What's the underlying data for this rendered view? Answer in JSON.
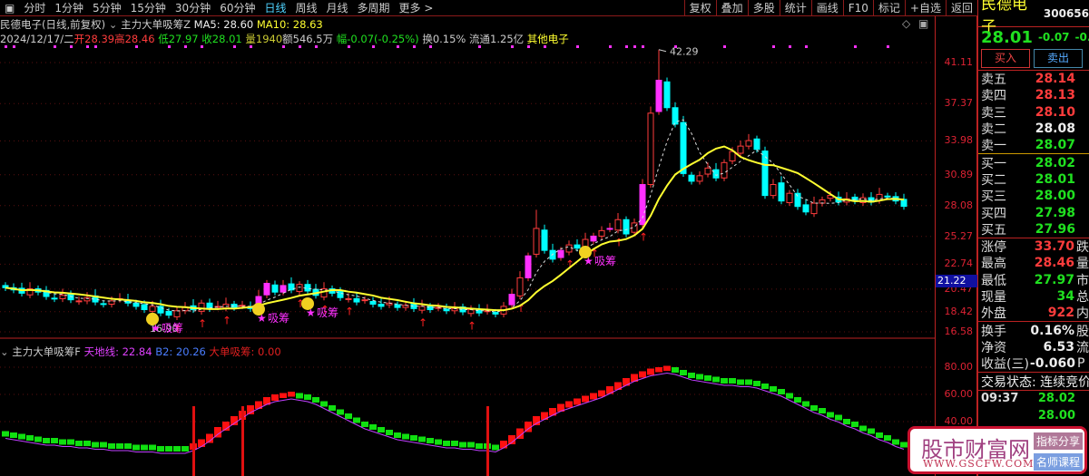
{
  "toolbar": {
    "periods": [
      "分时",
      "1分钟",
      "5分钟",
      "15分钟",
      "30分钟",
      "60分钟",
      "日线",
      "周线",
      "月线",
      "多周期",
      "更多 >"
    ],
    "active": "日线",
    "actions": [
      "复权",
      "叠加",
      "多股",
      "统计",
      "画线",
      "F10",
      "标记",
      "+自选",
      "返回"
    ]
  },
  "info": {
    "title": "民德电子(日线,前复权)",
    "indicator": "主力大单吸筹Z",
    "ma5": "MA5: 28.60",
    "ma10": "MA10: 28.63",
    "date": "2024/12/17/二",
    "open": "开28.39",
    "high": "高28.46",
    "low": "低27.97",
    "close": "收28.01",
    "vol": "量1940",
    "amount": "额546.5万",
    "change": "幅-0.07(-0.25%)",
    "turnover": "换0.15%",
    "float": "流通1.25亿",
    "sector": "其他电子"
  },
  "chart_data": {
    "type": "candlestick",
    "price_axis_ticks": [
      "41.11",
      "37.37",
      "33.98",
      "30.89",
      "28.08",
      "25.27",
      "22.74",
      "20.47",
      "18.42",
      "16.58"
    ],
    "ylim": [
      16.58,
      41.11
    ],
    "current_price_tag": "21.22",
    "high_label": "42.29",
    "low_label": "16.90",
    "closes": [
      20.6,
      20.4,
      20.1,
      20.5,
      20.2,
      19.8,
      19.6,
      19.9,
      19.5,
      19.4,
      19.7,
      19.3,
      19.1,
      19.4,
      19.6,
      19.2,
      18.9,
      18.6,
      18.9,
      18.3,
      18.1,
      18.5,
      18.8,
      18.6,
      19.2,
      18.7,
      18.9,
      19.1,
      18.8,
      19.0,
      18.7,
      19.8,
      21.0,
      20.2,
      20.8,
      20.4,
      20.9,
      20.3,
      19.9,
      20.5,
      20.1,
      19.7,
      19.6,
      19.3,
      19.5,
      19.1,
      18.9,
      19.2,
      18.8,
      19.0,
      18.7,
      18.9,
      18.6,
      18.8,
      18.5,
      18.7,
      18.4,
      18.6,
      18.3,
      18.5,
      18.2,
      18.9,
      20.0,
      21.5,
      23.5,
      26.0,
      24.0,
      23.2,
      24.0,
      24.5,
      24.2,
      25.0,
      25.3,
      25.8,
      26.0,
      26.8,
      25.5,
      26.5,
      30.0,
      36.5,
      39.5,
      37.0,
      35.5,
      31.0,
      30.3,
      30.8,
      31.5,
      30.6,
      32.0,
      33.0,
      33.5,
      34.0,
      33.2,
      29.0,
      30.0,
      28.5,
      29.2,
      28.0,
      27.5,
      28.3,
      28.6,
      29.0,
      28.4,
      28.7,
      28.5,
      28.8,
      28.4,
      29.1,
      28.9,
      28.5,
      28.01
    ],
    "signals": [
      {
        "bar": 18,
        "label": "吸筹"
      },
      {
        "bar": 31,
        "label": "吸筹"
      },
      {
        "bar": 37,
        "label": "吸筹"
      },
      {
        "bar": 71,
        "label": "吸筹"
      }
    ],
    "sub": {
      "name": "主力大单吸筹F",
      "line1": "天地线: 22.84",
      "line2": "B2: 20.26",
      "line3": "大单吸筹: 0.00",
      "axis": [
        "80.00",
        "60.00",
        "40.00"
      ],
      "ylim": [
        30,
        100
      ],
      "values": [
        33,
        32,
        31,
        30,
        29,
        28,
        28,
        27,
        27,
        26,
        26,
        25,
        25,
        24,
        24,
        24,
        23,
        23,
        23,
        22,
        22,
        22,
        22,
        24,
        27,
        31,
        36,
        40,
        44,
        48,
        52,
        55,
        58,
        60,
        61,
        62,
        61,
        60,
        58,
        55,
        52,
        49,
        46,
        43,
        40,
        38,
        36,
        34,
        32,
        31,
        30,
        29,
        28,
        27,
        26,
        26,
        25,
        25,
        24,
        24,
        23,
        26,
        30,
        35,
        40,
        44,
        47,
        50,
        53,
        55,
        57,
        59,
        61,
        63,
        66,
        69,
        72,
        75,
        77,
        79,
        80,
        81,
        80,
        78,
        76,
        75,
        74,
        73,
        72,
        72,
        71,
        71,
        70,
        68,
        66,
        64,
        61,
        58,
        55,
        52,
        50,
        47,
        45,
        42,
        40,
        37,
        35,
        32,
        30,
        27,
        25
      ],
      "spike_bars": [
        23,
        29,
        59
      ]
    },
    "colors": {
      "up": "#ff3c3c",
      "down": "#00ffff",
      "ma": "#ffff30",
      "signal": "#ff30ff",
      "sub_line": "#c040ff"
    }
  },
  "right": {
    "name": "民德电子",
    "code": "300656",
    "price": "28.01",
    "chg": "-0.07",
    "pct": "-0.2",
    "buy": "买入",
    "sell": "卖出",
    "asks": [
      {
        "k": "卖五",
        "v": "28.14",
        "c": "red"
      },
      {
        "k": "卖四",
        "v": "28.13",
        "c": "red"
      },
      {
        "k": "卖三",
        "v": "28.10",
        "c": "red"
      },
      {
        "k": "卖二",
        "v": "28.08",
        "c": "wht"
      },
      {
        "k": "卖一",
        "v": "28.07",
        "c": "grn"
      }
    ],
    "bids": [
      {
        "k": "买一",
        "v": "28.02",
        "c": "grn"
      },
      {
        "k": "买二",
        "v": "28.01",
        "c": "grn"
      },
      {
        "k": "买三",
        "v": "28.00",
        "c": "grn"
      },
      {
        "k": "买四",
        "v": "27.98",
        "c": "grn"
      },
      {
        "k": "买五",
        "v": "27.96",
        "c": "grn"
      }
    ],
    "stats": [
      {
        "k": "涨停",
        "v": "33.70",
        "c": "red",
        "x": "跌"
      },
      {
        "k": "最高",
        "v": "28.46",
        "c": "red",
        "x": "量"
      },
      {
        "k": "最低",
        "v": "27.97",
        "c": "grn",
        "x": "市"
      },
      {
        "k": "现量",
        "v": "34",
        "c": "grn",
        "x": "总"
      },
      {
        "k": "外盘",
        "v": "922",
        "c": "red",
        "x": "内"
      }
    ],
    "stats2": [
      {
        "k": "换手",
        "v": "0.16%",
        "c": "wht",
        "x": "股"
      },
      {
        "k": "净资",
        "v": "6.53",
        "c": "wht",
        "x": "流"
      },
      {
        "k": "收益(三)",
        "v": "-0.060",
        "c": "wht",
        "x": "P"
      }
    ],
    "status": "交易状态: 连续竞价",
    "ticks": [
      {
        "t": "09:37",
        "v": "28.02"
      },
      {
        "t": "",
        "v": "28.00"
      }
    ]
  },
  "watermark": {
    "name": "股市财富网",
    "url": "WWW.GSCFW.COM",
    "tag1": "指标分享",
    "tag2": "名师课程"
  }
}
